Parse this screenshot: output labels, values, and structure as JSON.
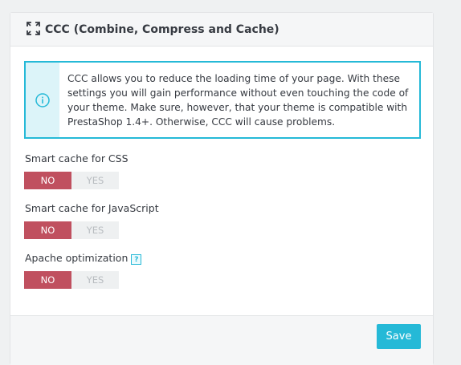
{
  "panel": {
    "title": "CCC (Combine, Compress and Cache)",
    "title_icon": "expand-icon"
  },
  "alert": {
    "icon": "info-icon",
    "text": "CCC allows you to reduce the loading time of your page. With these settings you will gain performance without even touching the code of your theme. Make sure, however, that your theme is compatible with PrestaShop 1.4+. Otherwise, CCC will cause problems."
  },
  "fields": [
    {
      "label": "Smart cache for CSS",
      "no_label": "NO",
      "yes_label": "YES",
      "value": "NO"
    },
    {
      "label": "Smart cache for JavaScript",
      "no_label": "NO",
      "yes_label": "YES",
      "value": "NO"
    },
    {
      "label": "Apache optimization",
      "help": "?",
      "no_label": "NO",
      "yes_label": "YES",
      "value": "NO"
    }
  ],
  "footer": {
    "save_label": "Save"
  },
  "colors": {
    "accent": "#25b9d7",
    "toggle_off": "#c0505f"
  }
}
